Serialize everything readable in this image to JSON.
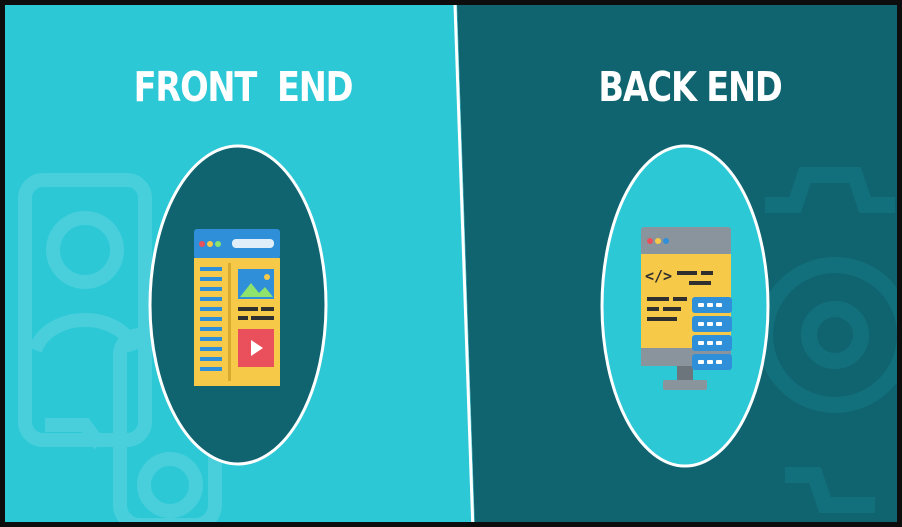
{
  "panels": {
    "front_end": {
      "title": "FRONT  END",
      "icon": "web-page-icon",
      "background_color": "#2cc8d6",
      "circle_color": "#0f6470"
    },
    "back_end": {
      "title": "BACK END",
      "icon": "code-server-icon",
      "background_color": "#0f6470",
      "circle_color": "#2cc8d6",
      "code_tag": "</>"
    }
  },
  "colors": {
    "white": "#ffffff",
    "frame": "#0d0d0d",
    "yellow": "#f7c948",
    "blue": "#2f8fd8",
    "red": "#e9505b",
    "gray": "#8a949c"
  }
}
